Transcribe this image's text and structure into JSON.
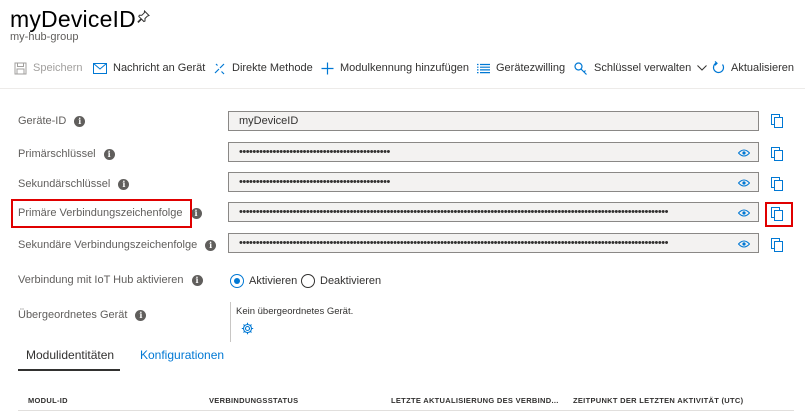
{
  "header": {
    "title": "myDeviceID",
    "subtitle": "my-hub-group"
  },
  "toolbar": {
    "save": "Speichern",
    "message": "Nachricht an Gerät",
    "direct_method": "Direkte Methode",
    "add_module": "Modulkennung hinzufügen",
    "twin": "Gerätezwilling",
    "manage_keys": "Schlüssel verwalten",
    "refresh": "Aktualisieren"
  },
  "fields": {
    "device_id": {
      "label": "Geräte-ID",
      "value": "myDeviceID"
    },
    "primary_key": {
      "label": "Primärschlüssel",
      "value": "•••••••••••••••••••••••••••••••••••••••••••••"
    },
    "secondary_key": {
      "label": "Sekundärschlüssel",
      "value": "•••••••••••••••••••••••••••••••••••••••••••••"
    },
    "primary_conn": {
      "label": "Primäre Verbindungszeichenfolge",
      "value": "••••••••••••••••••••••••••••••••••••••••••••••••••••••••••••••••••••••••••••••••••••••••••••••••••••••••••••••••••••••••••••••••"
    },
    "secondary_conn": {
      "label": "Sekundäre Verbindungszeichenfolge",
      "value": "••••••••••••••••••••••••••••••••••••••••••••••••••••••••••••••••••••••••••••••••••••••••••••••••••••••••••••••••••••••••••••••••"
    }
  },
  "iot_connection": {
    "label": "Verbindung mit IoT Hub aktivieren",
    "enable": "Aktivieren",
    "disable": "Deaktivieren",
    "selected": "Aktivieren"
  },
  "parent_device": {
    "label": "Übergeordnetes Gerät",
    "value": "Kein übergeordnetes Gerät."
  },
  "tabs": {
    "module_identities": "Modulidentitäten",
    "configurations": "Konfigurationen"
  },
  "table": {
    "columns": [
      "MODUL-ID",
      "VERBINDUNGSSTATUS",
      "LETZTE AKTUALISIERUNG DES VERBIND...",
      "ZEITPUNKT DER LETZTEN AKTIVITÄT (UTC)"
    ]
  },
  "colors": {
    "accent": "#0078d4",
    "highlight": "#e00000"
  },
  "icons": [
    "pin-icon",
    "save-icon",
    "mail-icon",
    "direct-method-icon",
    "plus-icon",
    "list-icon",
    "key-icon",
    "chevron-down-icon",
    "refresh-icon",
    "info-icon",
    "eye-icon",
    "copy-icon",
    "gear-icon"
  ]
}
